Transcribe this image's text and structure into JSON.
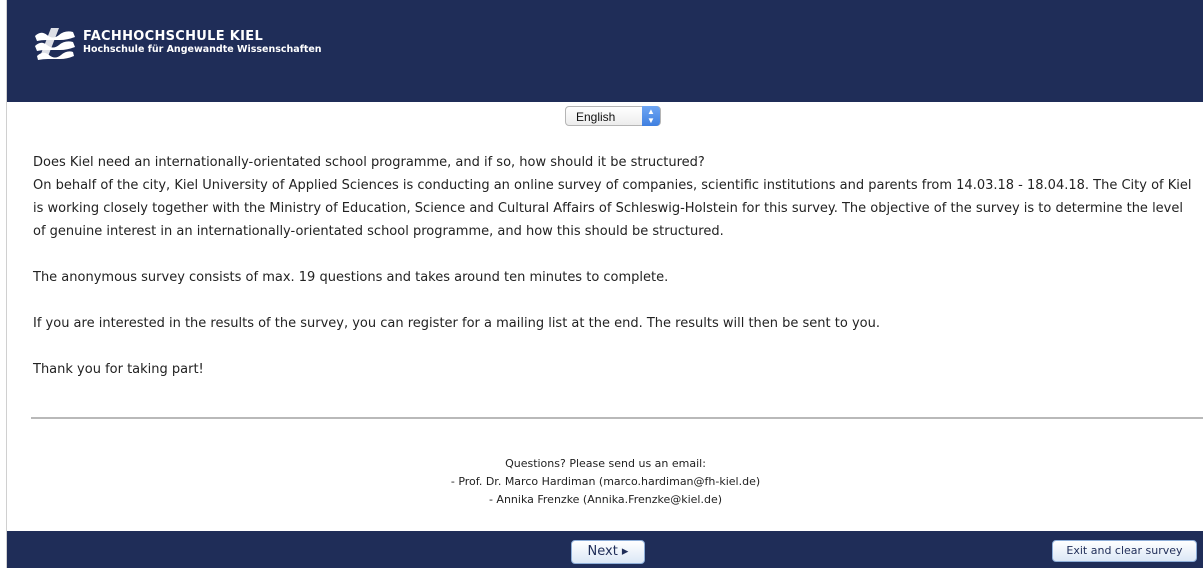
{
  "header": {
    "logo_title": "FACHHOCHSCHULE KIEL",
    "logo_subtitle": "Hochschule für Angewandte Wissenschaften",
    "background": "#1f2d58"
  },
  "language": {
    "selected": "English"
  },
  "intro": {
    "question": "Does Kiel need an internationally-orientated school programme, and if so, how should it be structured?",
    "body": "On behalf of the city, Kiel University of Applied Sciences is conducting an online survey of companies, scientific institutions and parents from 14.03.18 - 18.04.18. The City of Kiel is working closely together with the Ministry of Education, Science and Cultural Affairs of Schleswig-Holstein for this survey. The objective of the survey is to determine the level of genuine interest in an internationally-orientated school programme, and how this should be structured.",
    "duration": "The anonymous survey consists of max. 19 questions and takes around ten minutes to complete.",
    "mailing": "If you are interested in the results of the survey, you can register for a mailing list at the end. The results will then be sent to you.",
    "thanks": "Thank you for taking part!"
  },
  "contact": {
    "heading": "Questions? Please send us an email:",
    "person1": "- Prof. Dr. Marco Hardiman (marco.hardiman@fh-kiel.de)",
    "person2": "- Annika Frenzke (Annika.Frenzke@kiel.de)"
  },
  "footer": {
    "next_label": "Next ▸",
    "exit_label": "Exit and clear survey"
  }
}
